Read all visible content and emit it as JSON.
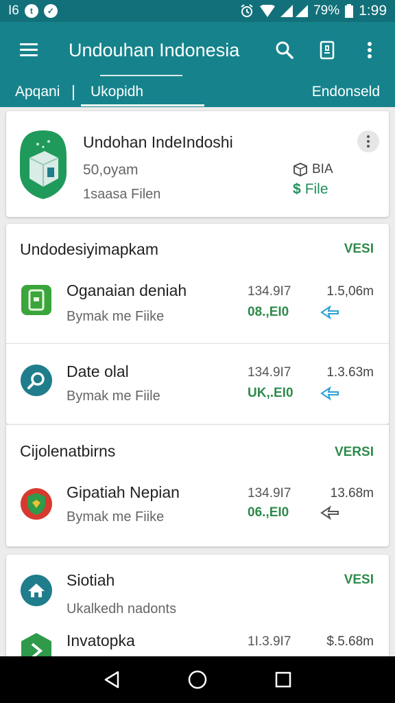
{
  "status_bar": {
    "left_text": "I6",
    "battery": "79%",
    "time": "1:99"
  },
  "toolbar": {
    "title": "Undouhan Indonesia"
  },
  "tabs": {
    "left": "Apqani",
    "active": "Ukopidh",
    "right": "Endonseld"
  },
  "hero": {
    "title": "Undohan IndeIndoshi",
    "size": "50,oyam",
    "subtitle": "1saasa Filen",
    "badge": "BIA",
    "file_label": "File"
  },
  "section1": {
    "header": "Undodesiyimapkam",
    "action": "VESI",
    "rows": [
      {
        "title": "Oganaian deniah",
        "subtitle": "Bymak me Fiike",
        "num1": "134.9I7",
        "code": "08.,EI0",
        "num2": "1.5,06m",
        "icon": "green-app-icon"
      },
      {
        "title": "Date olal",
        "subtitle": "Bymak me Fiile",
        "num1": "134.9I7",
        "code": "UK,.EI0",
        "num2": "1.3.63m",
        "icon": "teal-search-icon"
      }
    ]
  },
  "section2": {
    "header": "Cijolenatbirns",
    "action": "VERSI",
    "rows": [
      {
        "title": "Gipatiah Nepian",
        "subtitle": "Bymak me Fiike",
        "num1": "134.9I7",
        "code": "06.,EI0",
        "num2": "13.68m",
        "icon": "red-shield-icon"
      }
    ]
  },
  "section3": {
    "header": "Siotiah",
    "action": "VESI",
    "subtitle": "Ukalkedh nadonts",
    "row": {
      "title": "Invatopka",
      "num1": "1I.3.9I7",
      "num2": "$.5.68m",
      "icon": "green-arrow-icon"
    }
  },
  "colors": {
    "primary": "#16838c",
    "status_bar": "#12707a",
    "accent_green": "#2e8b4b",
    "action_blue": "#2a9fd6"
  }
}
